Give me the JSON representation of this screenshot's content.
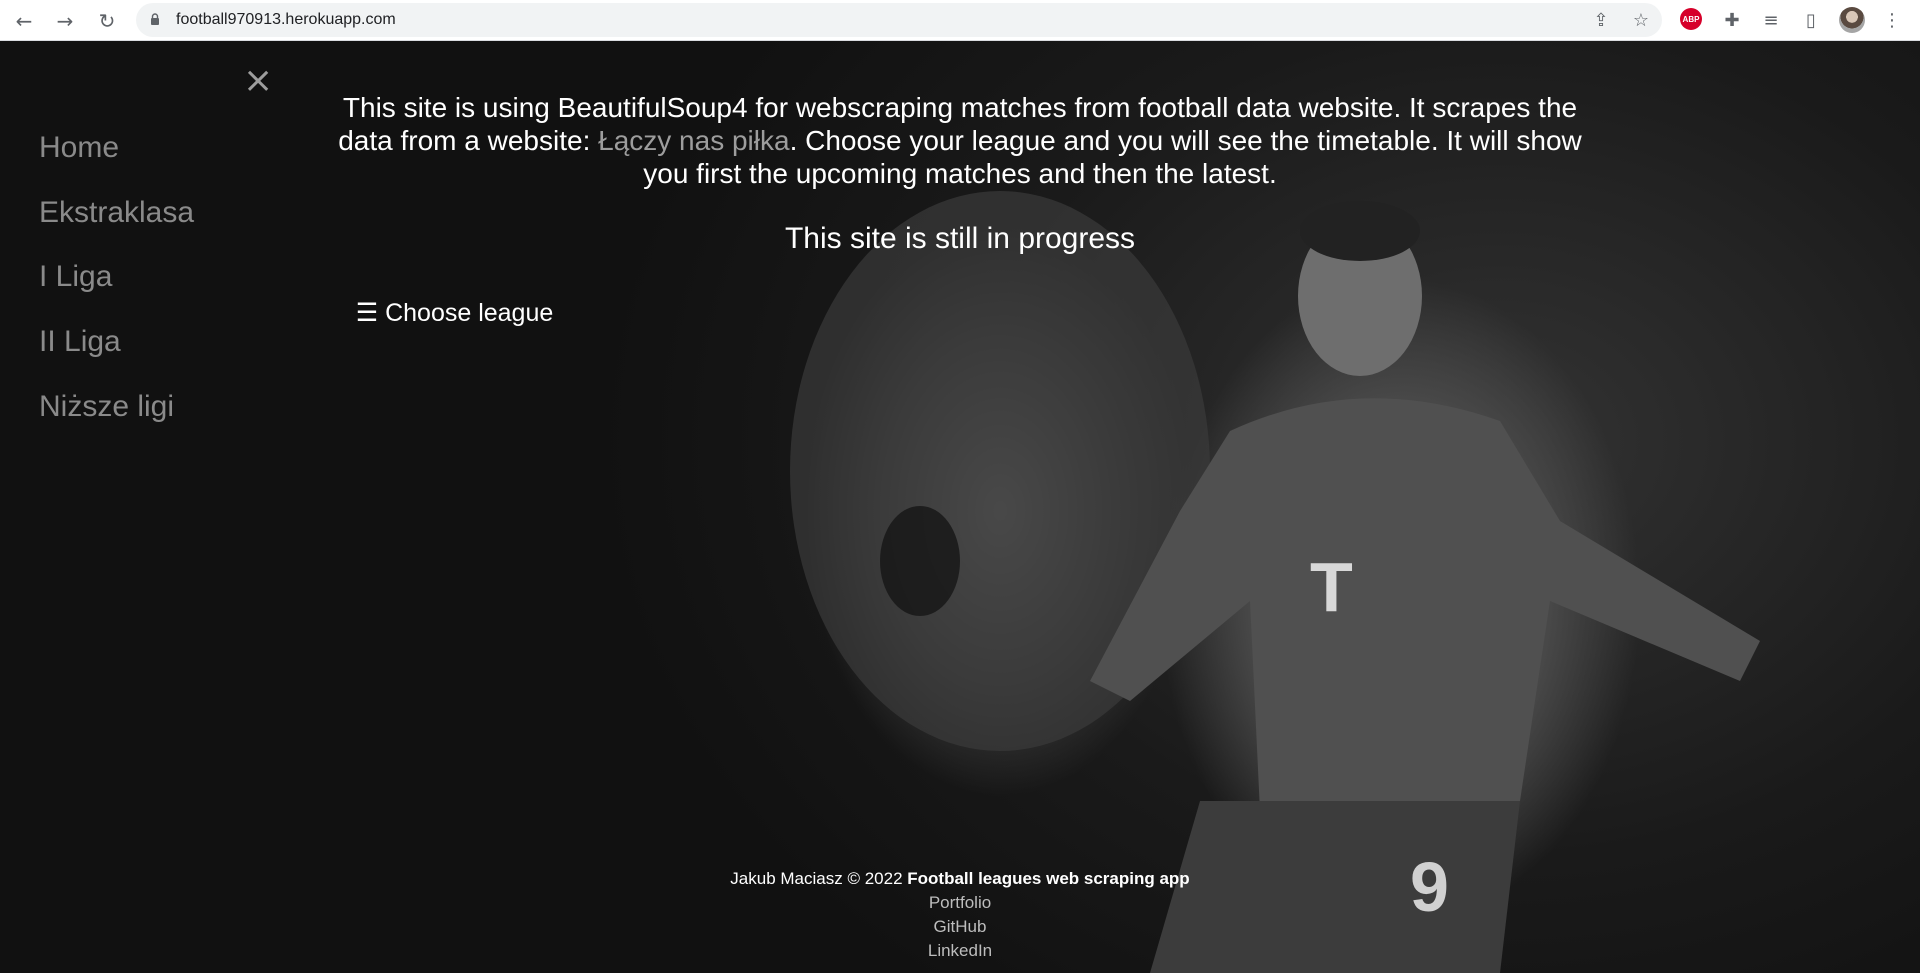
{
  "browser": {
    "url": "football970913.herokuapp.com",
    "icons": {
      "back": "arrow-left-icon",
      "forward": "arrow-right-icon",
      "reload": "reload-icon",
      "share": "share-icon",
      "bookmark": "star-icon",
      "adblock": "ABP",
      "extensions": "puzzle-icon",
      "reading_list": "reading-list-icon",
      "side_panel": "side-panel-icon",
      "menu": "kebab-menu-icon"
    }
  },
  "sidebar": {
    "close_label": "×",
    "items": [
      {
        "label": "Home"
      },
      {
        "label": "Ekstraklasa"
      },
      {
        "label": "I Liga"
      },
      {
        "label": "II Liga"
      },
      {
        "label": "Niższe ligi"
      }
    ]
  },
  "main": {
    "intro_before": "This site is using BeautifulSoup4 for webscraping matches from football data website. It scrapes the data from a website: ",
    "intro_link": "Łączy nas piłka",
    "intro_after": ". Choose your league and you will see the timetable. It will show you first the upcoming matches and then the latest.",
    "progress": "This site is still in progress",
    "choose_league": "☰ Choose league"
  },
  "footer": {
    "author": "Jakub Maciasz © 2022 ",
    "brand": "Football leagues web scraping app",
    "links": [
      "Portfolio",
      "GitHub",
      "LinkedIn"
    ]
  },
  "colors": {
    "sidebar_bg": "#111111",
    "nav_text": "#8a8a8a",
    "link_text": "#9d9d9d",
    "text": "#ffffff"
  }
}
